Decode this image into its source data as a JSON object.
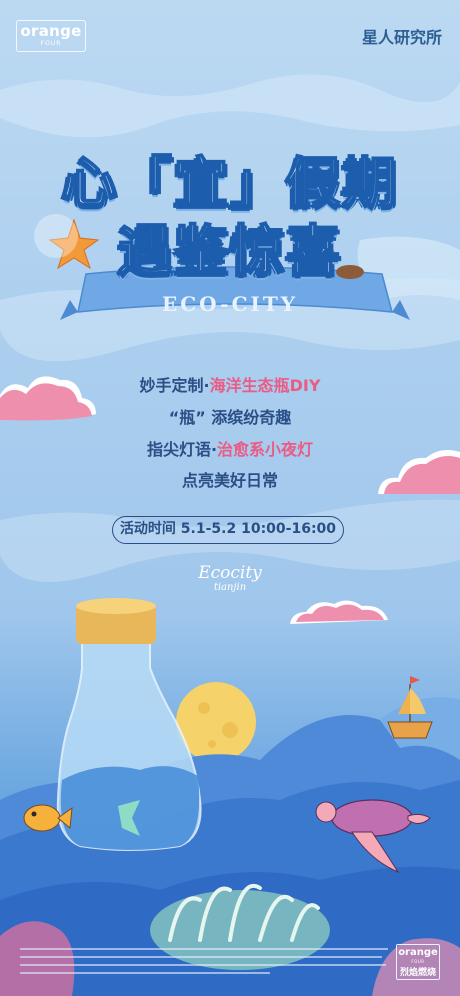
{
  "header": {
    "logo_main": "orange",
    "logo_sub": "FOUR",
    "brand_right": "星人研究所"
  },
  "title": {
    "line1": "心「宜」假期",
    "line2": "遇鉴惊喜",
    "ribbon": "ECO-CITY"
  },
  "activities": [
    {
      "dark": "妙手定制·",
      "pink": "海洋生态瓶DIY"
    },
    {
      "dark": "“瓶” 添缤纷奇趣",
      "pink": ""
    },
    {
      "dark": "指尖灯语·",
      "pink": "治愈系小夜灯"
    },
    {
      "dark": "点亮美好日常",
      "pink": ""
    }
  ],
  "time_label": "活动时间 5.1-5.2 10:00-16:00",
  "eco_script": "Ecocity",
  "eco_script_sub": "tianjin",
  "footer_logo": {
    "main": "orange",
    "sub": "FOUR",
    "cn": "烈焰燃烧"
  },
  "colors": {
    "title_stroke": "#1d5dad",
    "text_dark": "#2a4f86",
    "text_pink": "#ea5c85",
    "cloud_pink": "#ef8fae"
  }
}
